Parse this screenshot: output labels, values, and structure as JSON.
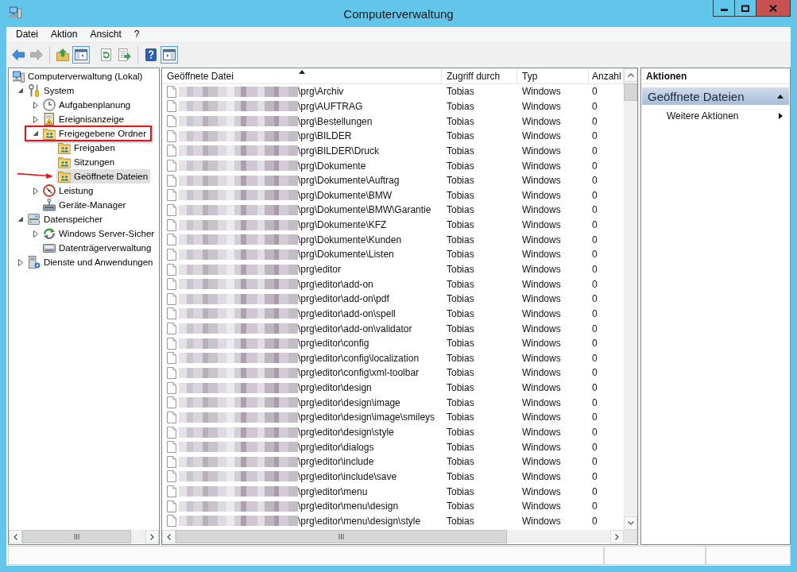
{
  "window": {
    "title": "Computerverwaltung"
  },
  "menu": [
    "Datei",
    "Aktion",
    "Ansicht",
    "?"
  ],
  "toolbar": [
    {
      "buttons": [
        {
          "pressed": false,
          "disabled": false
        },
        {
          "pressed": false,
          "disabled": true
        }
      ]
    },
    {
      "separator": true,
      "buttons": [
        {
          "pressed": false,
          "disabled": false
        },
        {
          "pressed": true,
          "disabled": false
        }
      ]
    },
    {
      "separator": false,
      "buttons": [
        {
          "pressed": false,
          "disabled": false
        },
        {
          "pressed": false,
          "disabled": false
        }
      ]
    },
    {
      "separator": true,
      "buttons": [
        {
          "pressed": false,
          "disabled": false
        },
        {
          "pressed": true,
          "disabled": false
        }
      ]
    }
  ],
  "tree": [
    {
      "label": "Computerverwaltung (Lokal)",
      "selected": false,
      "children": [
        {
          "label": "System",
          "expanded": true,
          "selected": false,
          "children": [
            {
              "label": "Aufgabenplanung",
              "expanded": false,
              "selected": false
            },
            {
              "label": "Ereignisanzeige",
              "expanded": false,
              "selected": false
            },
            {
              "label": "Freigegebene Ordner",
              "expanded": true,
              "selected": false,
              "highlight_box": true,
              "children": [
                {
                  "label": "Freigaben",
                  "selected": false
                },
                {
                  "label": "Sitzungen",
                  "selected": false
                },
                {
                  "label": "Geöffnete Dateien",
                  "selected": true,
                  "pointer_arrow": true
                }
              ]
            },
            {
              "label": "Leistung",
              "expanded": false,
              "selected": false
            },
            {
              "label": "Geräte-Manager",
              "selected": false
            }
          ]
        },
        {
          "label": "Datenspeicher",
          "expanded": true,
          "selected": false,
          "children": [
            {
              "label": "Windows Server-Sicher",
              "expanded": false,
              "selected": false
            },
            {
              "label": "Datenträgerverwaltung",
              "selected": false
            }
          ]
        },
        {
          "label": "Dienste und Anwendungen",
          "expanded": false,
          "selected": false
        }
      ]
    }
  ],
  "table": {
    "columns": [
      {
        "label": "Geöffnete Datei",
        "sorted": true
      },
      {
        "label": "Zugriff durch",
        "sorted": false
      },
      {
        "label": "Typ",
        "sorted": false
      },
      {
        "label": "Anzahl",
        "sorted": false
      }
    ],
    "rows": [
      {
        "path_redacted": true,
        "cells": [
          "\\prg\\Archiv",
          "Tobias",
          "Windows",
          "0"
        ]
      },
      {
        "path_redacted": true,
        "cells": [
          "\\prg\\AUFTRAG",
          "Tobias",
          "Windows",
          "0"
        ]
      },
      {
        "path_redacted": true,
        "cells": [
          "\\prg\\Bestellungen",
          "Tobias",
          "Windows",
          "0"
        ]
      },
      {
        "path_redacted": true,
        "cells": [
          "\\prg\\BILDER",
          "Tobias",
          "Windows",
          "0"
        ]
      },
      {
        "path_redacted": true,
        "cells": [
          "\\prg\\BILDER\\Druck",
          "Tobias",
          "Windows",
          "0"
        ]
      },
      {
        "path_redacted": true,
        "cells": [
          "\\prg\\Dokumente",
          "Tobias",
          "Windows",
          "0"
        ]
      },
      {
        "path_redacted": true,
        "cells": [
          "\\prg\\Dokumente\\Auftrag",
          "Tobias",
          "Windows",
          "0"
        ]
      },
      {
        "path_redacted": true,
        "cells": [
          "\\prg\\Dokumente\\BMW",
          "Tobias",
          "Windows",
          "0"
        ]
      },
      {
        "path_redacted": true,
        "cells": [
          "\\prg\\Dokumente\\BMW\\Garantie",
          "Tobias",
          "Windows",
          "0"
        ]
      },
      {
        "path_redacted": true,
        "cells": [
          "\\prg\\Dokumente\\KFZ",
          "Tobias",
          "Windows",
          "0"
        ]
      },
      {
        "path_redacted": true,
        "cells": [
          "\\prg\\Dokumente\\Kunden",
          "Tobias",
          "Windows",
          "0"
        ]
      },
      {
        "path_redacted": true,
        "cells": [
          "\\prg\\Dokumente\\Listen",
          "Tobias",
          "Windows",
          "0"
        ]
      },
      {
        "path_redacted": true,
        "cells": [
          "\\prg\\editor",
          "Tobias",
          "Windows",
          "0"
        ]
      },
      {
        "path_redacted": true,
        "cells": [
          "\\prg\\editor\\add-on",
          "Tobias",
          "Windows",
          "0"
        ]
      },
      {
        "path_redacted": true,
        "cells": [
          "\\prg\\editor\\add-on\\pdf",
          "Tobias",
          "Windows",
          "0"
        ]
      },
      {
        "path_redacted": true,
        "cells": [
          "\\prg\\editor\\add-on\\spell",
          "Tobias",
          "Windows",
          "0"
        ]
      },
      {
        "path_redacted": true,
        "cells": [
          "\\prg\\editor\\add-on\\validator",
          "Tobias",
          "Windows",
          "0"
        ]
      },
      {
        "path_redacted": true,
        "cells": [
          "\\prg\\editor\\config",
          "Tobias",
          "Windows",
          "0"
        ]
      },
      {
        "path_redacted": true,
        "cells": [
          "\\prg\\editor\\config\\localization",
          "Tobias",
          "Windows",
          "0"
        ]
      },
      {
        "path_redacted": true,
        "cells": [
          "\\prg\\editor\\config\\xml-toolbar",
          "Tobias",
          "Windows",
          "0"
        ]
      },
      {
        "path_redacted": true,
        "cells": [
          "\\prg\\editor\\design",
          "Tobias",
          "Windows",
          "0"
        ]
      },
      {
        "path_redacted": true,
        "cells": [
          "\\prg\\editor\\design\\image",
          "Tobias",
          "Windows",
          "0"
        ]
      },
      {
        "path_redacted": true,
        "cells": [
          "\\prg\\editor\\design\\image\\smileys",
          "Tobias",
          "Windows",
          "0"
        ]
      },
      {
        "path_redacted": true,
        "cells": [
          "\\prg\\editor\\design\\style",
          "Tobias",
          "Windows",
          "0"
        ]
      },
      {
        "path_redacted": true,
        "cells": [
          "\\prg\\editor\\dialogs",
          "Tobias",
          "Windows",
          "0"
        ]
      },
      {
        "path_redacted": true,
        "cells": [
          "\\prg\\editor\\include",
          "Tobias",
          "Windows",
          "0"
        ]
      },
      {
        "path_redacted": true,
        "cells": [
          "\\prg\\editor\\include\\save",
          "Tobias",
          "Windows",
          "0"
        ]
      },
      {
        "path_redacted": true,
        "cells": [
          "\\prg\\editor\\menu",
          "Tobias",
          "Windows",
          "0"
        ]
      },
      {
        "path_redacted": true,
        "cells": [
          "\\prg\\editor\\menu\\design",
          "Tobias",
          "Windows",
          "0"
        ]
      },
      {
        "path_redacted": true,
        "cells": [
          "\\prg\\editor\\menu\\design\\style",
          "Tobias",
          "Windows",
          "0"
        ]
      }
    ]
  },
  "actions": {
    "title": "Aktionen",
    "sections": [
      {
        "title": "Geöffnete Dateien",
        "expanded": true,
        "items": [
          {
            "label": "Weitere Aktionen",
            "submenu": true
          }
        ]
      }
    ]
  }
}
